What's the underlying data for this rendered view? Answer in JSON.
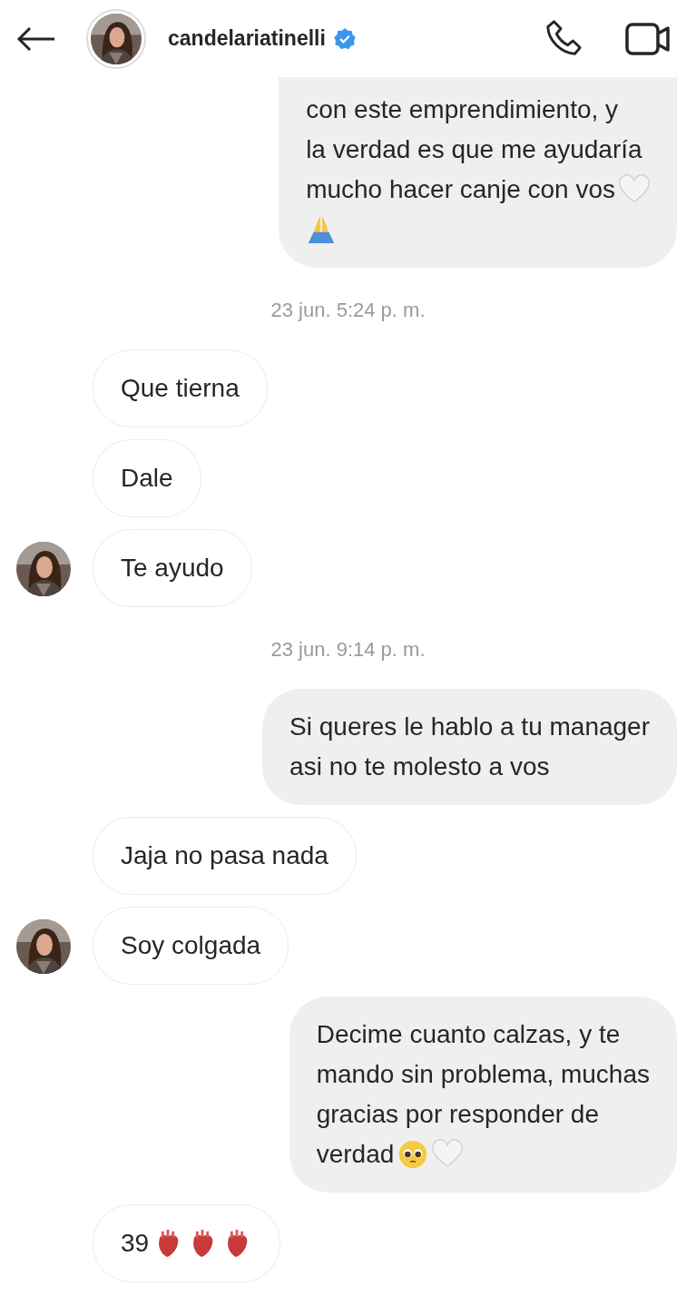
{
  "header": {
    "username": "candelariatinelli",
    "verified": true
  },
  "messages": [
    {
      "kind": "message",
      "outgoing": true,
      "cut_top": true,
      "lines": [
        {
          "text": "con este emprendimiento, y"
        },
        {
          "text": "la verdad es que me ayudaría"
        },
        {
          "text": "mucho hacer canje con vos",
          "emoji": [
            {
              "kind": "white-heart"
            }
          ]
        },
        {
          "emoji": [
            {
              "kind": "folded-hands"
            }
          ]
        }
      ]
    },
    {
      "kind": "time",
      "text": "23 jun. 5:24 p. m."
    },
    {
      "kind": "message",
      "outgoing": false,
      "avatar": false,
      "lines": [
        {
          "text": "Que tierna"
        }
      ]
    },
    {
      "kind": "message",
      "outgoing": false,
      "avatar": false,
      "lines": [
        {
          "text": "Dale"
        }
      ]
    },
    {
      "kind": "message",
      "outgoing": false,
      "avatar": true,
      "lines": [
        {
          "text": "Te ayudo"
        }
      ]
    },
    {
      "kind": "time",
      "text": "23 jun. 9:14 p. m."
    },
    {
      "kind": "message",
      "outgoing": true,
      "lines": [
        {
          "text": "Si queres le hablo a tu manager"
        },
        {
          "text": "asi no te molesto a vos"
        }
      ]
    },
    {
      "kind": "message",
      "outgoing": false,
      "avatar": false,
      "lines": [
        {
          "text": "Jaja no pasa nada"
        }
      ]
    },
    {
      "kind": "message",
      "outgoing": false,
      "avatar": true,
      "lines": [
        {
          "text": "Soy colgada"
        }
      ]
    },
    {
      "kind": "message",
      "outgoing": true,
      "lines": [
        {
          "text": "Decime cuanto calzas, y te"
        },
        {
          "text": "mando sin problema, muchas"
        },
        {
          "text": "gracias por responder de"
        },
        {
          "text": "verdad",
          "emoji": [
            {
              "kind": "pleading-face"
            },
            {
              "kind": "white-heart"
            }
          ]
        }
      ]
    },
    {
      "kind": "message",
      "outgoing": false,
      "avatar": false,
      "lines": [
        {
          "text": "39",
          "emoji": [
            {
              "kind": "anatomical-heart"
            },
            {
              "kind": "anatomical-heart"
            },
            {
              "kind": "anatomical-heart"
            }
          ]
        }
      ]
    }
  ]
}
